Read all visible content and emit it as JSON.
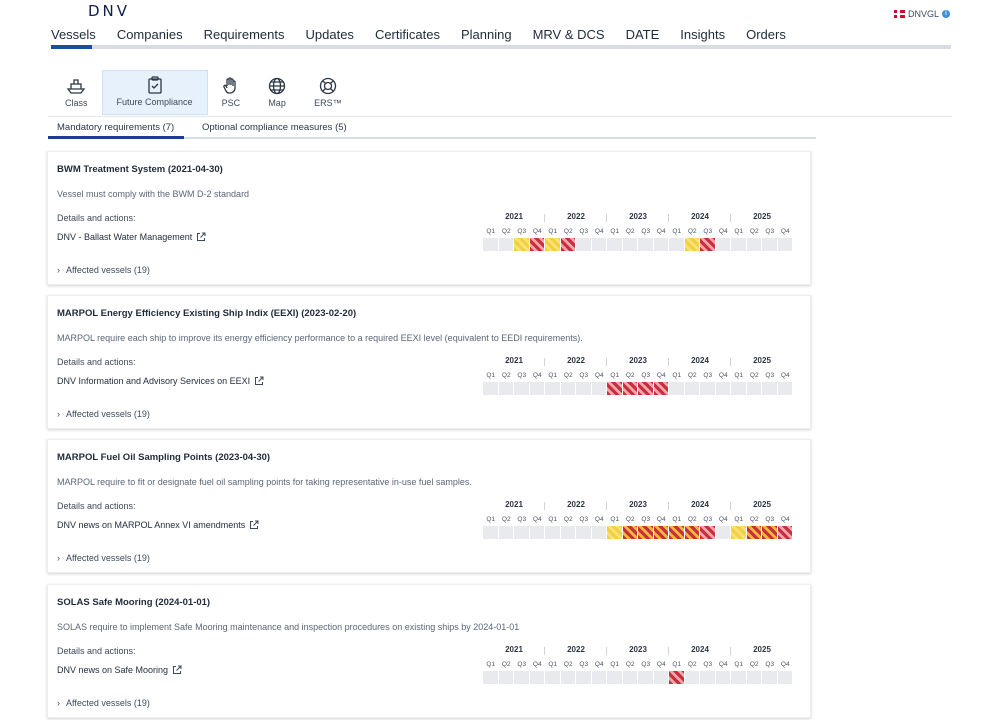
{
  "brand": "DNV",
  "user": {
    "name": "DNVGL"
  },
  "topnav": [
    "Vessels",
    "Companies",
    "Requirements",
    "Updates",
    "Certificates",
    "Planning",
    "MRV & DCS",
    "DATE",
    "Insights",
    "Orders"
  ],
  "subnav": [
    {
      "label": "Class",
      "icon": "ship-icon"
    },
    {
      "label": "Future Compliance",
      "icon": "clipboard-check-icon"
    },
    {
      "label": "PSC",
      "icon": "hand-stop-icon"
    },
    {
      "label": "Map",
      "icon": "globe-icon"
    },
    {
      "label": "ERS™",
      "icon": "lifebuoy-icon"
    }
  ],
  "req_tabs": {
    "mandatory": "Mandatory requirements (7)",
    "optional": "Optional compliance measures (5)"
  },
  "details_label": "Details and actions:",
  "years": [
    "2021",
    "2022",
    "2023",
    "2024",
    "2025"
  ],
  "quarters": [
    "Q1",
    "Q2",
    "Q3",
    "Q4"
  ],
  "status_colors": {
    "yellow": "#f4d03f",
    "red": "#c62f3c",
    "empty": "#e8eaed"
  },
  "requirements": [
    {
      "title": "BWM Treatment System (2021-04-30)",
      "description": "Vessel must comply with the BWM D-2 standard",
      "link": "DNV - Ballast Water Management",
      "affected": "Affected vessels (19)",
      "cells": [
        "",
        "",
        "y",
        "r",
        "y",
        "r",
        "",
        "",
        "",
        "",
        "",
        "",
        "",
        "y",
        "r",
        "",
        "",
        "",
        "",
        ""
      ]
    },
    {
      "title": "MARPOL Energy Efficiency Existing Ship Indix (EEXI) (2023-02-20)",
      "description": "MARPOL require each ship to improve its energy efficiency performance to a required EEXI level (equivalent to EEDI requirements).",
      "link": "DNV Information and Advisory Services on EEXI",
      "affected": "Affected vessels (19)",
      "cells": [
        "",
        "",
        "",
        "",
        "",
        "",
        "",
        "",
        "r",
        "r",
        "r",
        "r",
        "",
        "",
        "",
        "",
        "",
        "",
        "",
        ""
      ]
    },
    {
      "title": "MARPOL Fuel Oil Sampling Points (2023-04-30)",
      "description": "MARPOL require to fit or designate fuel oil sampling points for taking representative in-use fuel samples.",
      "link": "DNV news on MARPOL Annex VI amendments",
      "affected": "Affected vessels (19)",
      "cells": [
        "",
        "",
        "",
        "",
        "",
        "",
        "",
        "",
        "y",
        "o",
        "o",
        "o",
        "o",
        "o",
        "r",
        "",
        "y",
        "o",
        "o",
        "r"
      ]
    },
    {
      "title": "SOLAS Safe Mooring (2024-01-01)",
      "description": "SOLAS require to implement Safe Mooring maintenance and inspection procedures on existing ships by 2024-01-01",
      "link": "DNV news on Safe Mooring",
      "affected": "Affected vessels (19)",
      "cells": [
        "",
        "",
        "",
        "",
        "",
        "",
        "",
        "",
        "",
        "",
        "",
        "",
        "r",
        "",
        "",
        "",
        "",
        "",
        "",
        ""
      ]
    }
  ]
}
